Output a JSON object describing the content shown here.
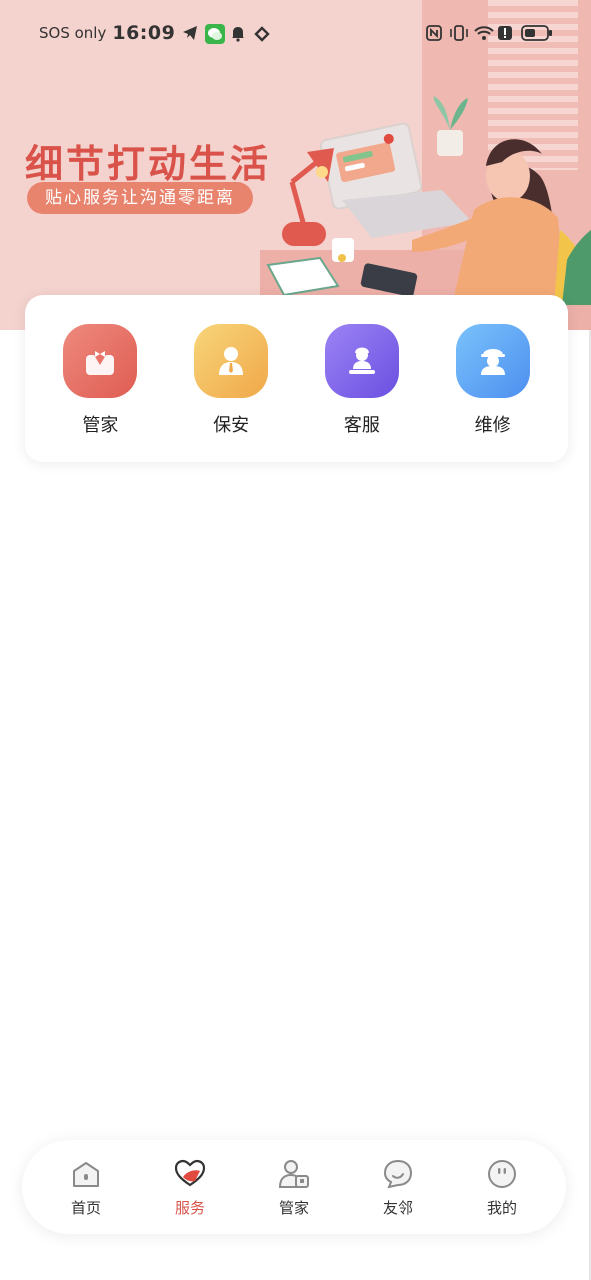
{
  "status_bar": {
    "carrier": "SOS only",
    "time": "16:09"
  },
  "banner": {
    "slogan": "细节打动生活",
    "subslogan": "贴心服务让沟通零距离"
  },
  "services": [
    {
      "label": "管家",
      "icon": "butler-icon",
      "color": "#e5665c"
    },
    {
      "label": "保安",
      "icon": "security-guard-icon",
      "color": "#f2b24f"
    },
    {
      "label": "客服",
      "icon": "customer-service-icon",
      "color": "#7a5de8"
    },
    {
      "label": "维修",
      "icon": "repairman-icon",
      "color": "#5b9df3"
    }
  ],
  "tabbar": {
    "active": "服务",
    "accent": "#d9534a",
    "items": [
      {
        "label": "首页",
        "icon": "home-icon"
      },
      {
        "label": "服务",
        "icon": "heart-hand-icon"
      },
      {
        "label": "管家",
        "icon": "butler-person-icon"
      },
      {
        "label": "友邻",
        "icon": "chat-bubble-icon"
      },
      {
        "label": "我的",
        "icon": "profile-face-icon"
      }
    ]
  }
}
